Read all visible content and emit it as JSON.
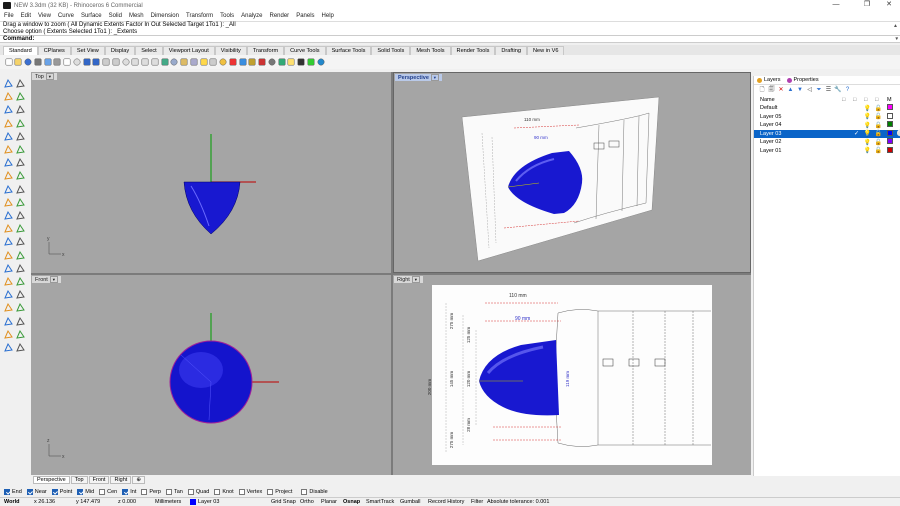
{
  "window": {
    "title": "NEW 3.3dm (32 KB) - Rhinoceros 6 Commercial",
    "controls": {
      "minimize": "—",
      "maximize": "❐",
      "close": "✕"
    }
  },
  "menu": [
    "File",
    "Edit",
    "View",
    "Curve",
    "Surface",
    "Solid",
    "Mesh",
    "Dimension",
    "Transform",
    "Tools",
    "Analyze",
    "Render",
    "Panels",
    "Help"
  ],
  "command": {
    "history": [
      "Drag a window to zoom ( All  Dynamic  Extents  Factor  In  Out  Selected  Target  1To1 ): _All",
      "Choose option ( Extents  Selected  1To1 ): _Extents"
    ],
    "prompt": "Command:"
  },
  "toolbar_tabs": [
    "Standard",
    "CPlanes",
    "Set View",
    "Display",
    "Select",
    "Viewport Layout",
    "Visibility",
    "Transform",
    "Curve Tools",
    "Surface Tools",
    "Solid Tools",
    "Mesh Tools",
    "Render Tools",
    "Drafting",
    "New in V6"
  ],
  "toolbar_icons": [
    "new-file-icon",
    "open-file-icon",
    "save-icon",
    "print-icon",
    "import-icon",
    "cut-icon",
    "copy-icon",
    "paste-icon",
    "undo-icon",
    "redo-icon",
    "pan-icon",
    "rotate-view-icon",
    "zoom-icon",
    "zoom-window-icon",
    "zoom-extents-icon",
    "zoom-selected-icon",
    "undo-view-icon",
    "four-views-icon",
    "cplane-icon",
    "set-view-icon",
    "show-icon",
    "hide-icon",
    "lock-icon",
    "layer-icon",
    "properties-icon",
    "material-icon",
    "sphere-render-icon",
    "render-icon",
    "render-preview-icon",
    "light-icon",
    "rhino-logo-icon",
    "options-icon",
    "help-icon"
  ],
  "viewports": {
    "top": "Top",
    "perspective": "Perspective",
    "front": "Front",
    "right": "Right"
  },
  "drawing_labels": {
    "d110": "110 mm",
    "d90": "90 mm",
    "d200": "200 mm",
    "d145": "145 mm",
    "d120": "120 mm",
    "d275": "275 mm",
    "d125": "125 mm",
    "d28": "28 mm",
    "d119": "119 mm"
  },
  "axis": {
    "x": "x",
    "y": "y",
    "z": "z"
  },
  "viewport_tabs": [
    "Perspective",
    "Top",
    "Front",
    "Right"
  ],
  "osnaps": [
    {
      "label": "End",
      "on": true
    },
    {
      "label": "Near",
      "on": true
    },
    {
      "label": "Point",
      "on": true
    },
    {
      "label": "Mid",
      "on": true
    },
    {
      "label": "Cen",
      "on": false
    },
    {
      "label": "Int",
      "on": true
    },
    {
      "label": "Perp",
      "on": false
    },
    {
      "label": "Tan",
      "on": false
    },
    {
      "label": "Quad",
      "on": false
    },
    {
      "label": "Knot",
      "on": false
    },
    {
      "label": "Vertex",
      "on": false
    },
    {
      "label": "Project",
      "on": false
    },
    {
      "label": "Disable",
      "on": false
    }
  ],
  "status": {
    "cplane": "World",
    "x": "x 26.136",
    "y": "y 147.479",
    "z": "z 0.000",
    "units": "Millimeters",
    "layer": "Layer 03",
    "grid_snap": "Grid Snap",
    "ortho": "Ortho",
    "planar": "Planar",
    "osnap": "Osnap",
    "smarttrack": "SmartTrack",
    "gumball": "Gumball",
    "record_history": "Record History",
    "filter": "Filter",
    "tolerance": "Absolute tolerance: 0.001"
  },
  "panel": {
    "tabs": [
      {
        "label": "Layers",
        "color": "#e2a020"
      },
      {
        "label": "Properties",
        "color": "#b040b0"
      }
    ],
    "header": {
      "name": "Name"
    },
    "layers": [
      {
        "name": "Default",
        "color": "#ff00ff",
        "selected": false
      },
      {
        "name": "Layer 05",
        "color": "#ffffff",
        "selected": false
      },
      {
        "name": "Layer 04",
        "color": "#008000",
        "selected": false
      },
      {
        "name": "Layer 03",
        "color": "#0000ff",
        "selected": true
      },
      {
        "name": "Layer 02",
        "color": "#8000ff",
        "selected": false
      },
      {
        "name": "Layer 01",
        "color": "#cc0000",
        "selected": false
      }
    ],
    "icons": {
      "bulb": "💡",
      "lock": "🔓",
      "check": "✓"
    }
  },
  "colors": {
    "viewport_bg": "#a5a5a5",
    "active_title": "#b9c9e8",
    "nose_cone": "#1212c8",
    "axis_x": "#c00000",
    "axis_y": "#00a000",
    "selection": "#0a64c8"
  }
}
